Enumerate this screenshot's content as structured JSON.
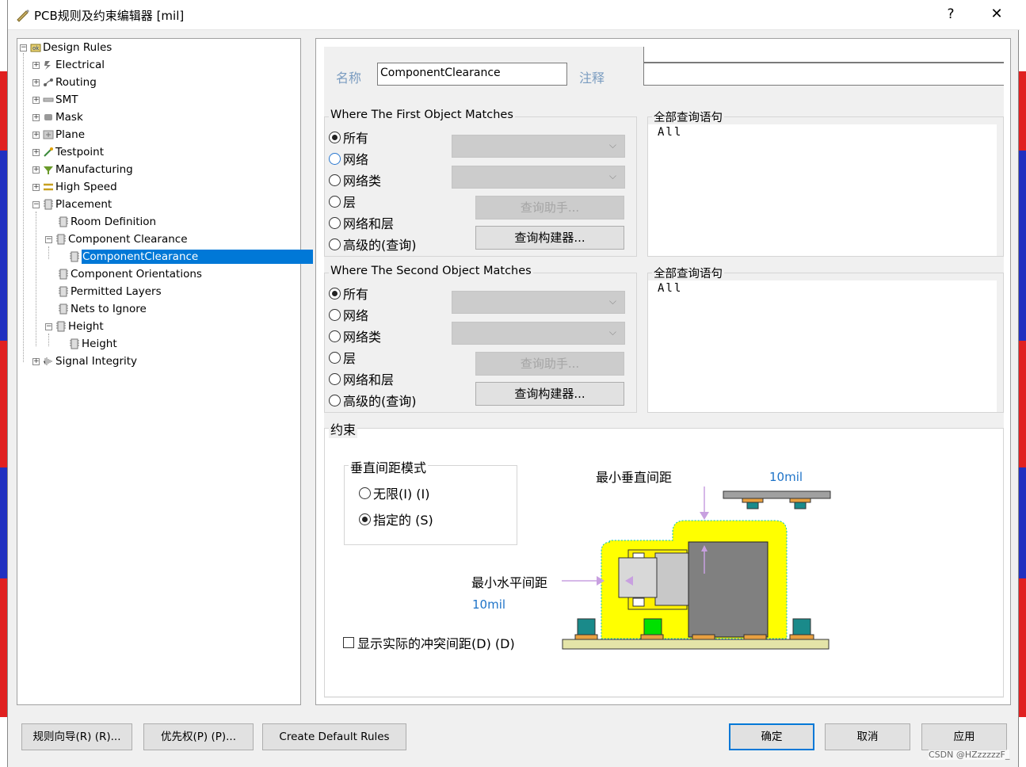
{
  "window": {
    "title": "PCB规则及约束编辑器 [mil]",
    "help_label": "?",
    "close_label": "✕"
  },
  "tree": {
    "root": "Design Rules",
    "items": [
      {
        "label": "Electrical"
      },
      {
        "label": "Routing"
      },
      {
        "label": "SMT"
      },
      {
        "label": "Mask"
      },
      {
        "label": "Plane"
      },
      {
        "label": "Testpoint"
      },
      {
        "label": "Manufacturing"
      },
      {
        "label": "High Speed"
      },
      {
        "label": "Placement"
      },
      {
        "label": "Room Definition"
      },
      {
        "label": "Component Clearance"
      },
      {
        "label": "ComponentClearance"
      },
      {
        "label": "Component Orientations"
      },
      {
        "label": "Permitted Layers"
      },
      {
        "label": "Nets to Ignore"
      },
      {
        "label": "Height"
      },
      {
        "label": "Height"
      },
      {
        "label": "Signal Integrity"
      }
    ],
    "selected": "ComponentClearance"
  },
  "rule": {
    "name_label": "名称",
    "name_value": "ComponentClearance",
    "comment_label": "注释",
    "comment_value": ""
  },
  "first_match": {
    "title": "Where The First Object Matches",
    "options": [
      "所有",
      "网络",
      "网络类",
      "层",
      "网络和层",
      "高级的(查询)"
    ],
    "selected": "所有",
    "query_helper": "查询助手...",
    "query_builder": "查询构建器...",
    "query_title": "全部查询语句",
    "query_text": "All"
  },
  "second_match": {
    "title": "Where The Second Object Matches",
    "options": [
      "所有",
      "网络",
      "网络类",
      "层",
      "网络和层",
      "高级的(查询)"
    ],
    "selected": "所有",
    "query_helper": "查询助手...",
    "query_builder": "查询构建器...",
    "query_title": "全部查询语句",
    "query_text": "All"
  },
  "constraints": {
    "title": "约束",
    "vertical_mode_title": "垂直间距模式",
    "mode_options": [
      "无限(I) (I)",
      "指定的 (S)"
    ],
    "mode_selected": "指定的 (S)",
    "min_vertical_label": "最小垂直间距",
    "min_vertical_value": "10mil",
    "min_horizontal_label": "最小水平间距",
    "min_horizontal_value": "10mil",
    "show_actual_label": "显示实际的冲突间距(D) (D)",
    "show_actual_checked": false
  },
  "footer": {
    "rule_wizard": "规则向导(R) (R)...",
    "priorities": "优先权(P) (P)...",
    "create_default": "Create Default Rules",
    "ok": "确定",
    "cancel": "取消",
    "apply": "应用"
  },
  "watermark": "CSDN @HZzzzzzF_",
  "colors": {
    "selection": "#0078d7",
    "link_blue": "#1e73c8",
    "clearance_yellow": "#ffff00",
    "pad_orange": "#e8a040"
  }
}
